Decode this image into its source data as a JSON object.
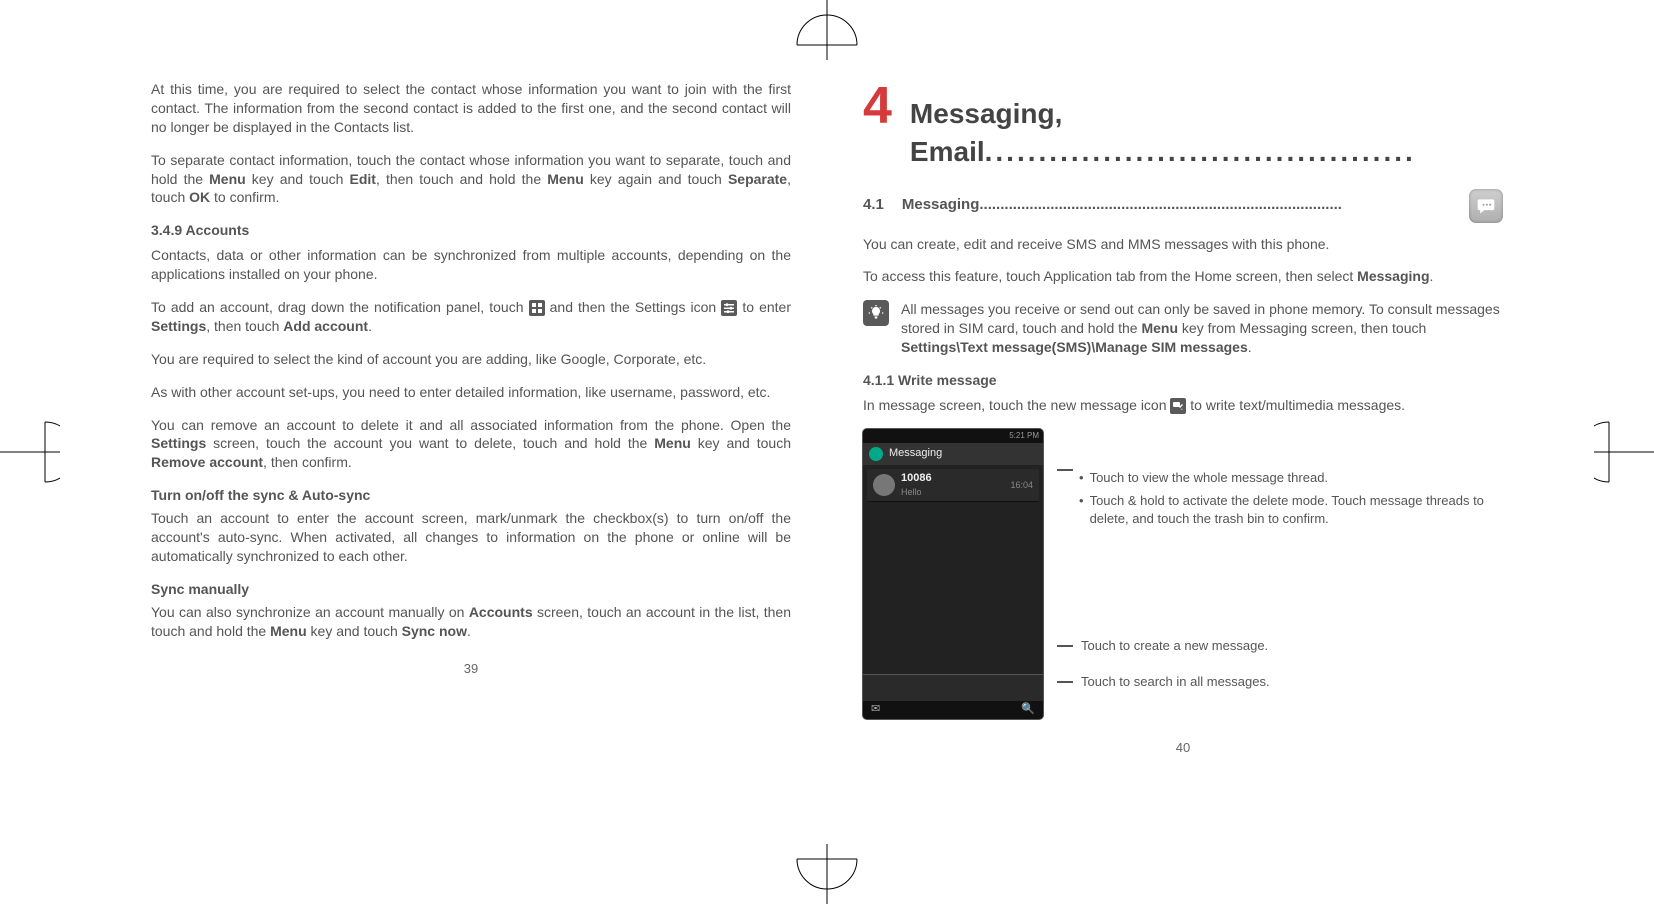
{
  "left": {
    "p1": "At this time, you are required to select the contact whose information you want to join with the first contact. The information from the second contact is added to the first one, and the second contact will no longer be displayed in the Contacts list.",
    "p2_a": "To separate contact information, touch the contact whose information you want to separate, touch and hold the ",
    "p2_b": " key and touch ",
    "p2_c": ", then touch and hold the ",
    "p2_d": " key again and touch ",
    "p2_e": ", touch ",
    "p2_f": " to confirm.",
    "menu": "Menu",
    "edit": "Edit",
    "separate": "Separate",
    "ok": "OK",
    "h349": "3.4.9   Accounts",
    "p3": "Contacts, data or other information can be synchronized from multiple accounts, depending on the applications installed on your phone.",
    "p4_a": "To add an account, drag down the notification panel, touch ",
    "p4_b": " and then the Settings icon ",
    "p4_c": " to enter ",
    "p4_d": ", then touch ",
    "p4_e": ".",
    "settings": "Settings",
    "addacct": "Add account",
    "p5": "You are required to select the kind of account you are adding, like Google, Corporate, etc.",
    "p6": "As with other account set-ups, you need to enter detailed information, like username, password, etc.",
    "p7_a": "You can remove an account to delete it and all associated information from the phone. Open the ",
    "p7_b": " screen, touch the account you want to delete, touch and hold the ",
    "p7_c": " key and touch ",
    "p7_d": ", then confirm.",
    "removeacct": "Remove account",
    "hsync": "Turn on/off the sync & Auto-sync",
    "p8": "Touch an account to enter the account screen, mark/unmark the checkbox(s) to turn on/off the account's auto-sync. When activated, all changes to information on the phone or online will be automatically synchronized to each other.",
    "hsyncman": "Sync manually",
    "p9_a": "You can also synchronize an account manually on ",
    "p9_b": " screen, touch an account in the list, then touch and hold the ",
    "p9_c": " key and touch ",
    "p9_d": ".",
    "accounts": "Accounts",
    "syncnow": "Sync now",
    "pagenum": "39"
  },
  "right": {
    "chapter_num": "4",
    "chapter_title": "Messaging, Email",
    "chapter_dots": "........................................",
    "sec_num": "4.1",
    "sec_title": "Messaging",
    "sec_dots": ".......................................................................................",
    "p1": "You can create, edit and receive SMS and MMS messages with this phone.",
    "p2_a": "To access this feature, touch Application tab from the Home screen, then select ",
    "p2_b": ".",
    "messaging": "Messaging",
    "tip_a": "All messages you receive or send out can only be saved in phone memory. To consult messages stored in SIM card, touch and hold the ",
    "tip_b": " key from Messaging screen, then touch ",
    "tip_c": ".",
    "menu": "Menu",
    "settings_path": "Settings\\Text message(SMS)\\Manage SIM messages",
    "h411": "4.1.1   Write message",
    "p3_a": "In message screen, touch the new message icon ",
    "p3_b": " to write text/multimedia messages.",
    "mock": {
      "status_time": "5:21 PM",
      "header": "Messaging",
      "thread_num": "10086",
      "thread_sub": "Hello",
      "thread_time": "16:04",
      "bottom_compose": "✉",
      "bottom_search": "🔍"
    },
    "annot1": "Touch to view the whole message thread.",
    "annot2": "Touch & hold to activate the delete mode. Touch message threads to delete, and touch the trash bin to confirm.",
    "annot3": "Touch to create a new message.",
    "annot4": "Touch to search in all messages.",
    "pagenum": "40"
  }
}
